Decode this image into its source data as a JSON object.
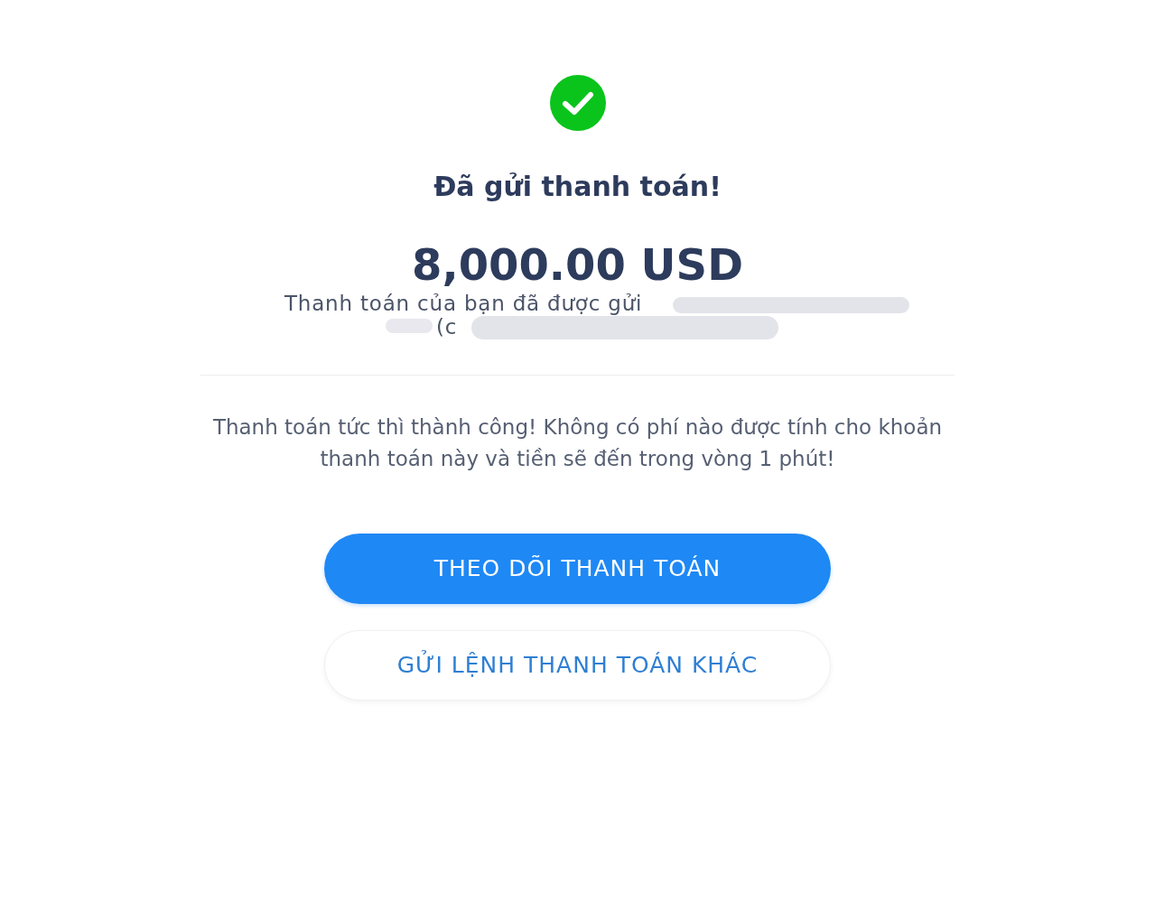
{
  "status": {
    "title": "Đã gửi thanh toán!",
    "amount": "8,000.00 USD",
    "recipient_lines": [
      "Thanh toán của bạn đã được gửi",
      "(c"
    ]
  },
  "message": "Thanh toán tức thì thành công! Không có phí nào được tính cho khoản thanh toán này và tiền sẽ đến trong vòng 1 phút!",
  "buttons": [
    {
      "label": "THEO DÕI THANH TOÁN",
      "kind": "primary"
    },
    {
      "label": "GỬI LỆNH THANH TOÁN KHÁC",
      "kind": "secondary"
    }
  ]
}
